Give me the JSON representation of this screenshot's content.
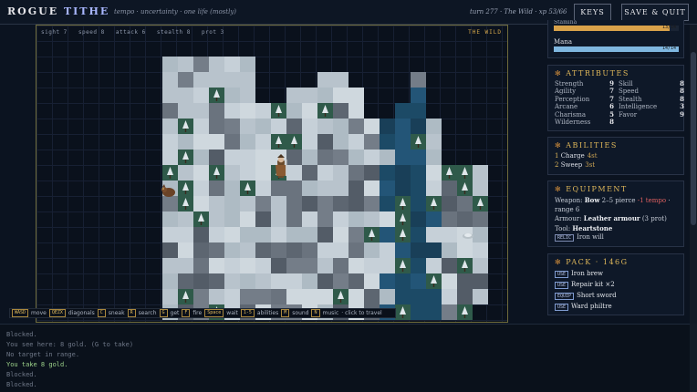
{
  "header": {
    "title_a": "ROGUE",
    "title_b": "TITHE",
    "tagline": "tempo · uncertainty · one life (mostly)",
    "status": "turn 277 · The Wild · xp 53/66",
    "keys_label": "KEYS",
    "save_label": "SAVE & QUIT"
  },
  "map": {
    "stats": [
      "sight 7",
      "speed 8",
      "attack 6",
      "stealth 8",
      "prot 3"
    ],
    "zone": "THE WILD"
  },
  "hints": [
    {
      "key": "WASD",
      "label": "move"
    },
    {
      "key": "QEZX",
      "label": "diagonals"
    },
    {
      "key": "C",
      "label": "sneak"
    },
    {
      "key": "R",
      "label": "search"
    },
    {
      "key": "G",
      "label": "get"
    },
    {
      "key": "F",
      "label": "fire"
    },
    {
      "key": "Space",
      "label": "wait"
    },
    {
      "key": "1-5",
      "label": "abilities"
    },
    {
      "key": "M",
      "label": "sound"
    },
    {
      "key": "N",
      "label": "music"
    }
  ],
  "hint_tail": "· click to travel",
  "log": [
    {
      "text": "Blocked.",
      "hl": false
    },
    {
      "text": "You see here: 8 gold. (G to take)",
      "hl": false
    },
    {
      "text": "No target in range.",
      "hl": false
    },
    {
      "text": "You take 8 gold.",
      "hl": true
    },
    {
      "text": "Blocked.",
      "hl": false
    },
    {
      "text": "Blocked.",
      "hl": false
    }
  ],
  "vitals": {
    "stamina_label": "Stamina",
    "stamina_value": "13/14",
    "stamina_fraction": 0.93,
    "stamina_color": "#d9a24a",
    "mana_label": "Mana",
    "mana_value": "14/14",
    "mana_fraction": 1.0,
    "mana_color": "#7fb7e0"
  },
  "attributes": {
    "title": "ATTRIBUTES",
    "left": [
      {
        "name": "Strength",
        "value": "9"
      },
      {
        "name": "Agility",
        "value": "7"
      },
      {
        "name": "Perception",
        "value": "7"
      },
      {
        "name": "Arcane",
        "value": "6"
      },
      {
        "name": "Charisma",
        "value": "5"
      },
      {
        "name": "Wilderness",
        "value": "8"
      }
    ],
    "right": [
      {
        "name": "Skill",
        "value": "8"
      },
      {
        "name": "Speed",
        "value": "8"
      },
      {
        "name": "Stealth",
        "value": "8"
      },
      {
        "name": "Intelligence",
        "value": "3"
      },
      {
        "name": "Favor",
        "value": "9"
      }
    ]
  },
  "abilities": {
    "title": "ABILITIES",
    "items": [
      {
        "key": "1",
        "name": "Charge",
        "cost": "4st"
      },
      {
        "key": "2",
        "name": "Sweep",
        "cost": "3st"
      }
    ]
  },
  "equipment": {
    "title": "EQUIPMENT",
    "weapon_label": "Weapon:",
    "weapon_name": "Bow",
    "weapon_stats": "2–5 pierce",
    "weapon_tempo": "-1 tempo",
    "weapon_range": "· range 6",
    "armour_label": "Armour:",
    "armour_name": "Leather armour",
    "armour_prot": "(3 prot)",
    "tool_label": "Tool:",
    "tool_name": "Heartstone",
    "relic_tag": "RELIC",
    "relic_name": "Iron will"
  },
  "pack": {
    "title": "PACK · 146G",
    "items": [
      {
        "tag": "USE",
        "name": "Iron brew"
      },
      {
        "tag": "USE",
        "name": "Repair kit ×2"
      },
      {
        "tag": "EQUIP",
        "name": "Short sword"
      },
      {
        "tag": "USE",
        "name": "Ward philtre"
      }
    ]
  },
  "colors": {
    "accent_gold": "#e0b85a",
    "snow": "#c4ced6",
    "rock": "#5d6671",
    "water": "#1c4a66",
    "pine": "#2f5a4a"
  }
}
